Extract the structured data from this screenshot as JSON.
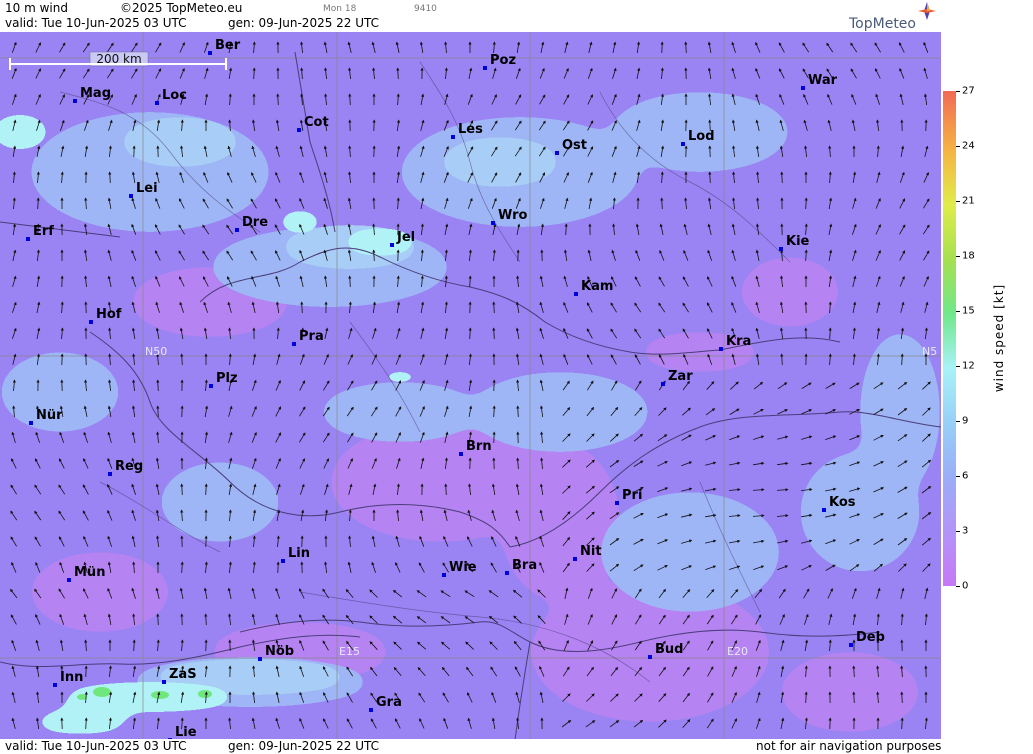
{
  "header": {
    "param": "10 m wind",
    "copyright": "©2025 TopMeteo.eu",
    "valid_text": "valid:  Tue  10-Jun-2025  03 UTC",
    "gen_text": "gen: 09-Jun-2025 22 UTC",
    "mon_text": "Mon 18",
    "num_text": "9410",
    "brand": "TopMeteo"
  },
  "footer": {
    "valid_text": "valid:  Tue  10-Jun-2025  03 UTC",
    "gen_text": "gen: 09-Jun-2025 22 UTC",
    "disclaimer": "not for air navigation purposes"
  },
  "scale_bar": {
    "label": "200 km"
  },
  "colorbar": {
    "title": "wind speed [kt]",
    "ticks": [
      "27",
      "24",
      "21",
      "18",
      "15",
      "12",
      "9",
      "6",
      "3",
      "0"
    ]
  },
  "coords": {
    "lat_left": "N50",
    "lat_right": "N5",
    "lon1": "E15",
    "lon2": "E20"
  },
  "colors": {
    "lilac": "#b583f2",
    "violet": "#9a83f3",
    "blue": "#9eb6f5",
    "lightblue": "#a8cdf6",
    "cyan": "#b1f2f7",
    "green": "#6fe77c"
  },
  "cities": [
    {
      "name": "Ber"
    },
    {
      "name": "Poz"
    },
    {
      "name": "War"
    },
    {
      "name": "Mag"
    },
    {
      "name": "Loc"
    },
    {
      "name": "Cot"
    },
    {
      "name": "Les"
    },
    {
      "name": "Lod"
    },
    {
      "name": "Ost"
    },
    {
      "name": "Lei"
    },
    {
      "name": "Erf"
    },
    {
      "name": "Dre"
    },
    {
      "name": "Wro"
    },
    {
      "name": "Jel"
    },
    {
      "name": "Kie"
    },
    {
      "name": "Kam"
    },
    {
      "name": "Hof"
    },
    {
      "name": "Pra"
    },
    {
      "name": "Kra"
    },
    {
      "name": "Plz"
    },
    {
      "name": "Zar"
    },
    {
      "name": "Nür"
    },
    {
      "name": "Brn"
    },
    {
      "name": "Reg"
    },
    {
      "name": "Pri"
    },
    {
      "name": "Kos"
    },
    {
      "name": "Lin"
    },
    {
      "name": "Nit"
    },
    {
      "name": "Wie"
    },
    {
      "name": "Bra"
    },
    {
      "name": "Mün"
    },
    {
      "name": "Deb"
    },
    {
      "name": "Nöb"
    },
    {
      "name": "Bud"
    },
    {
      "name": "Inn"
    },
    {
      "name": "ZaS"
    },
    {
      "name": "Gra"
    },
    {
      "name": "Lie"
    }
  ]
}
